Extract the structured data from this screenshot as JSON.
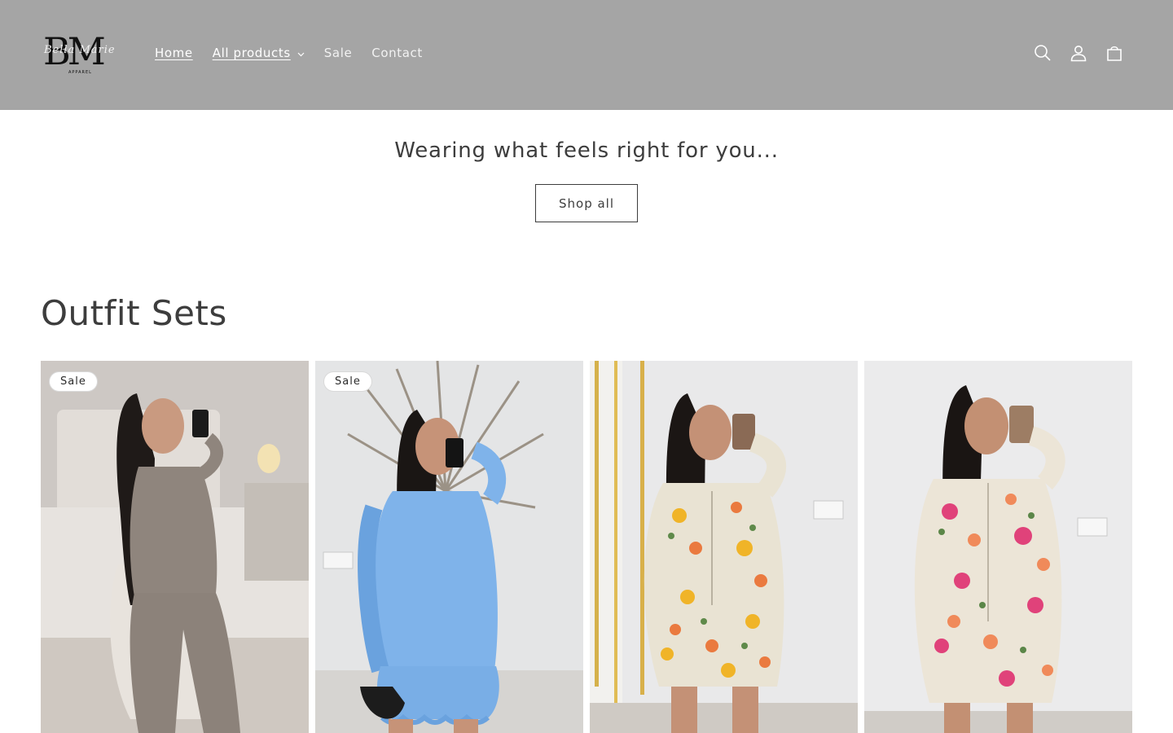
{
  "header": {
    "logo": {
      "letters": "BM",
      "script": "Bella Marie",
      "sub": "APPAREL"
    },
    "nav": [
      {
        "label": "Home"
      },
      {
        "label": "All products"
      },
      {
        "label": "Sale"
      },
      {
        "label": "Contact"
      }
    ],
    "icons": [
      "search-icon",
      "account-icon",
      "cart-icon"
    ]
  },
  "banner": {
    "heading": "Wearing what feels right for you...",
    "button": "Shop all"
  },
  "collection": {
    "title": "Outfit Sets",
    "products": [
      {
        "badge": "Sale",
        "image": "grey ribbed lounge set"
      },
      {
        "badge": "Sale",
        "image": "blue ruffle shirt and shorts set"
      },
      {
        "badge": "",
        "image": "yellow floral zip jacket playsuit"
      },
      {
        "badge": "",
        "image": "pink floral zip jacket playsuit"
      }
    ]
  },
  "colors": {
    "header_bg": "#a5a5a5",
    "text": "#3d3d3d",
    "nav_text": "#ffffff"
  }
}
